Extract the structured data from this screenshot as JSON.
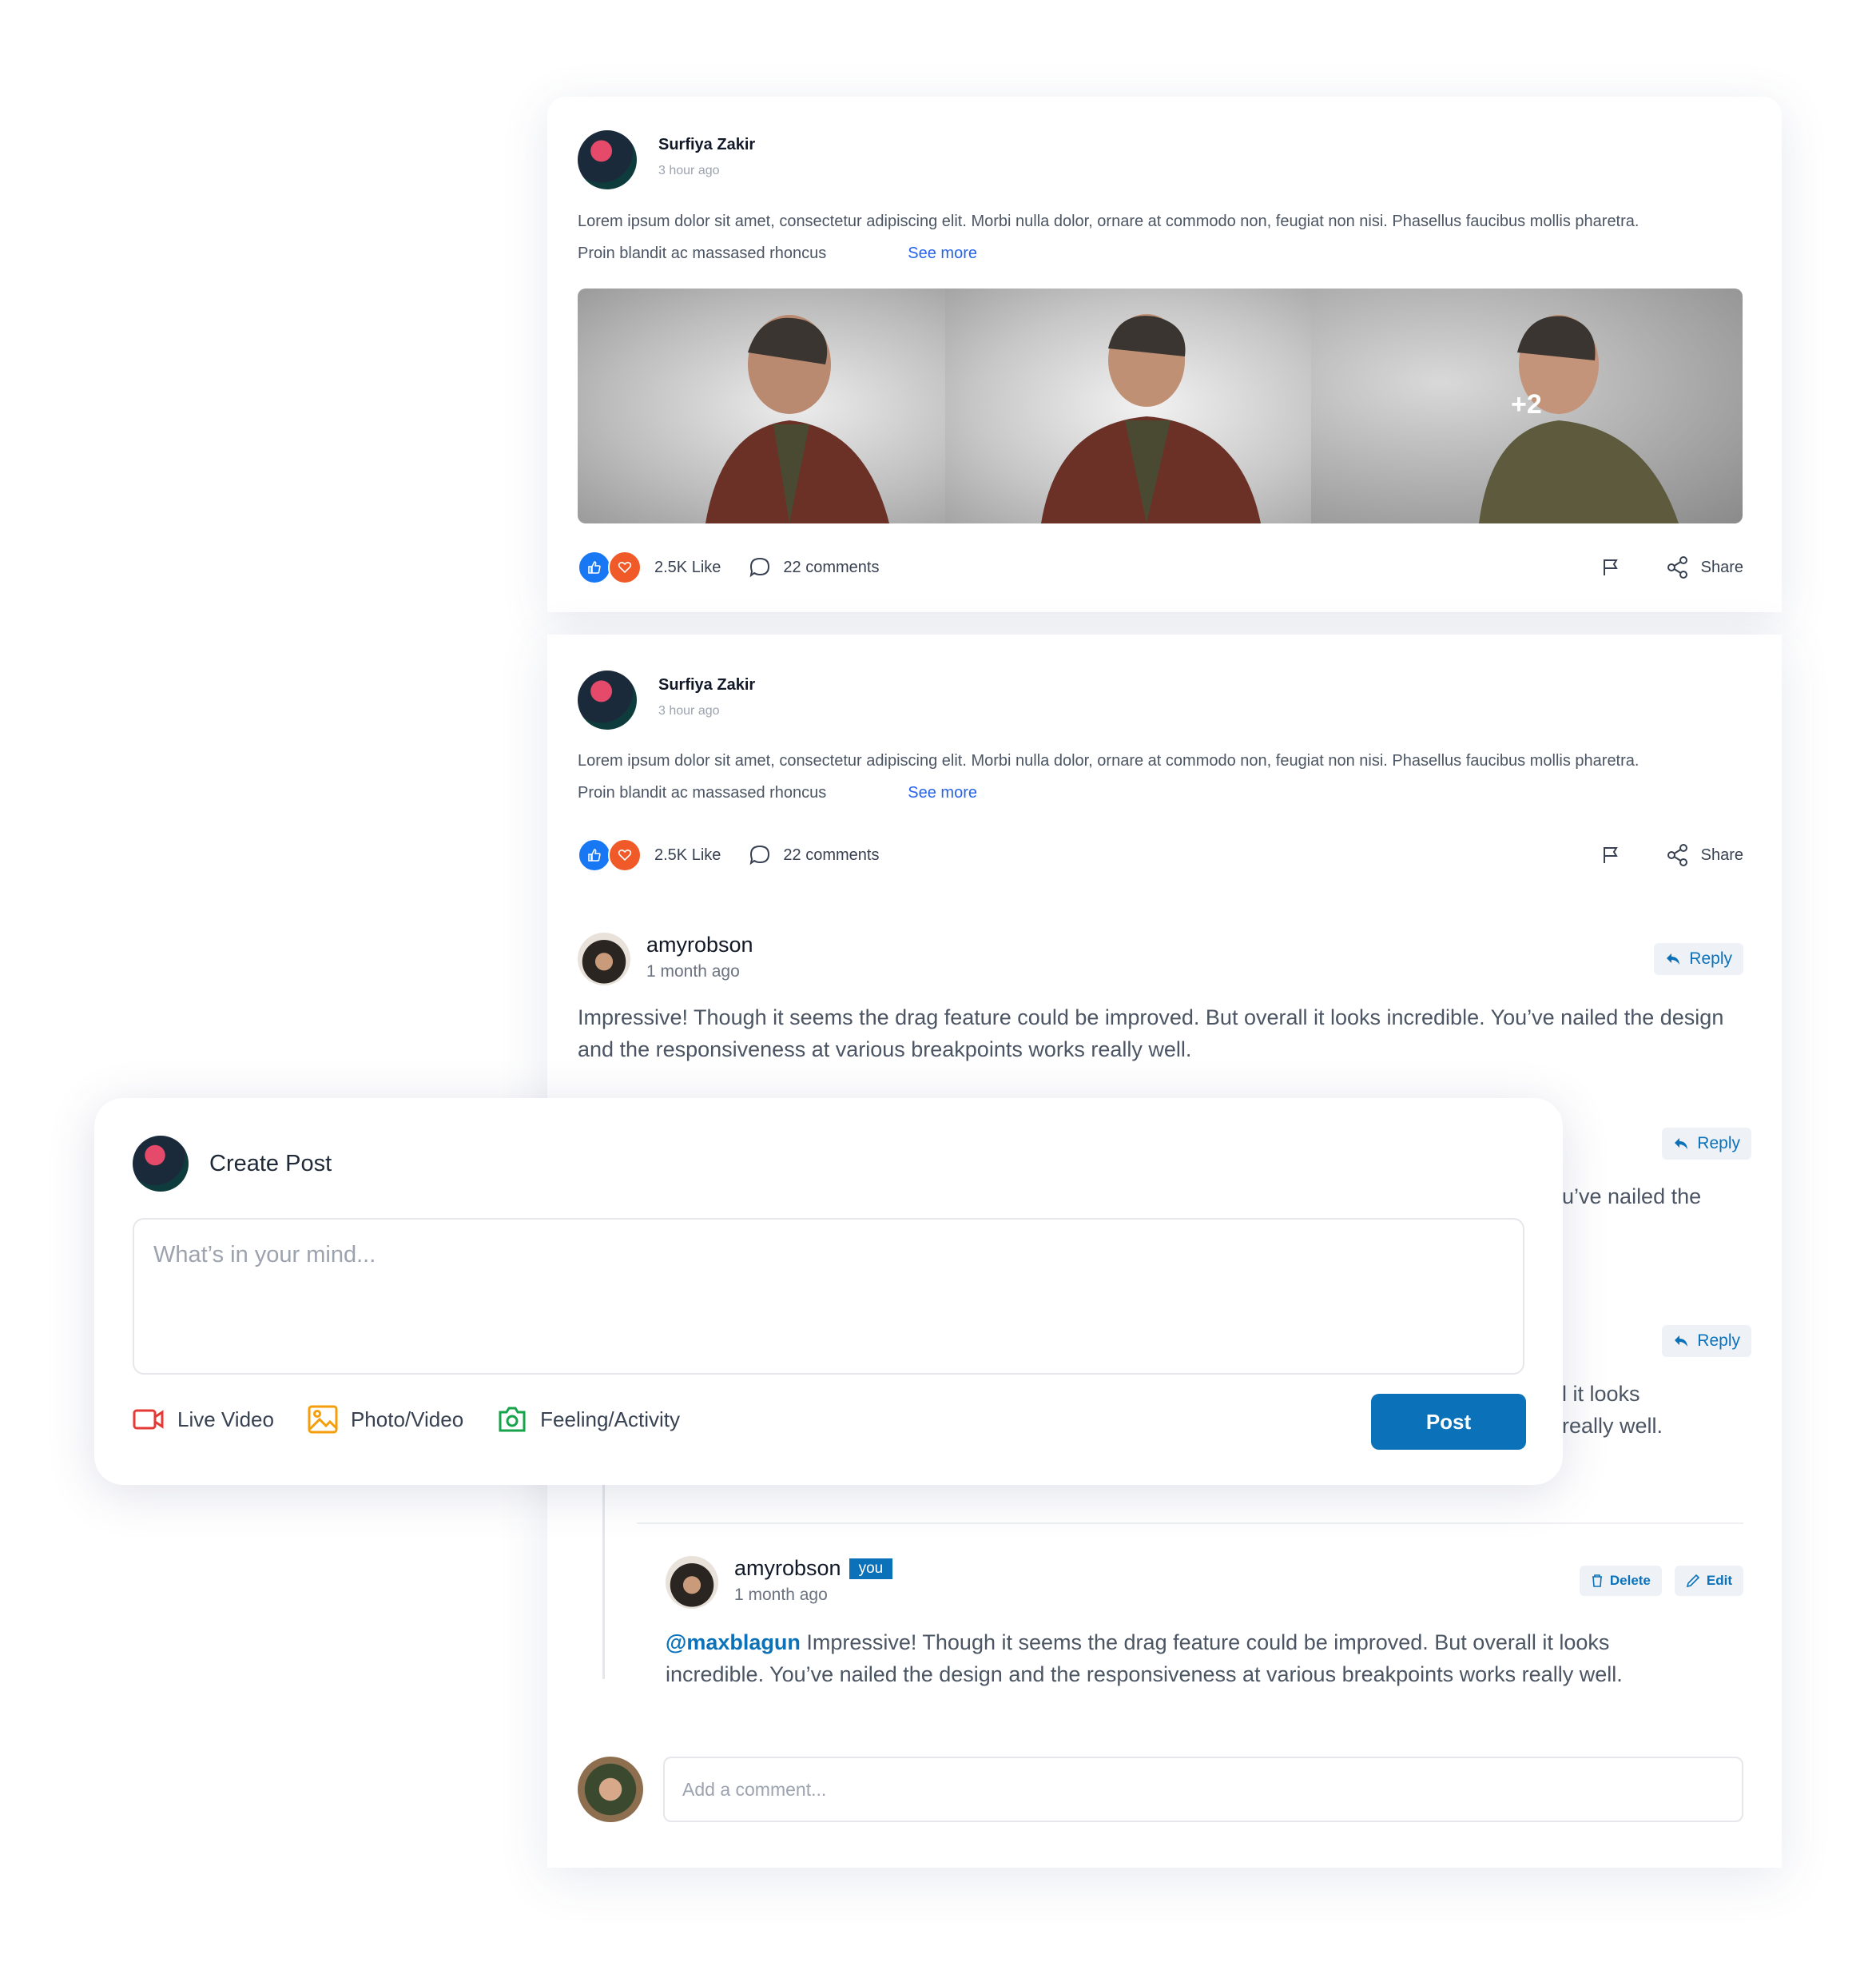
{
  "post1": {
    "author": "Surfiya Zakir",
    "time": "3 hour ago",
    "text_line1": "Lorem ipsum dolor sit amet, consectetur adipiscing elit. Morbi nulla dolor, ornare at commodo non, feugiat non nisi. Phasellus faucibus mollis pharetra.",
    "text_line2": "Proin blandit ac massased rhoncus",
    "see_more": "See more",
    "more_photos": "+2",
    "likes": "2.5K Like",
    "comments": "22 comments",
    "share": "Share"
  },
  "post2": {
    "author": "Surfiya Zakir",
    "time": "3 hour ago",
    "text_line1": "Lorem ipsum dolor sit amet, consectetur adipiscing elit. Morbi nulla dolor, ornare at commodo non, feugiat non nisi. Phasellus faucibus mollis pharetra.",
    "text_line2": "Proin blandit ac massased rhoncus",
    "see_more": "See more",
    "likes": "2.5K Like",
    "comments": "22 comments",
    "share": "Share"
  },
  "comment1": {
    "user": "amyrobson",
    "time": "1 month ago",
    "text": "Impressive! Though it seems the drag feature could be improved. But overall it looks incredible. You’ve nailed the design and the responsiveness at various breakpoints works really well.",
    "reply": "Reply"
  },
  "hidden_comments": {
    "reply2": "Reply",
    "reply3": "Reply",
    "frag1": "u’ve nailed the",
    "frag2": "l it looks",
    "frag3": "really well."
  },
  "own_reply": {
    "user": "amyrobson",
    "badge": "you",
    "time": "1 month ago",
    "mention": "@maxblagun",
    "text_line1": " Impressive! Though it seems the drag feature could be improved. But overall it looks",
    "text_line2": "incredible. You’ve nailed the design and the responsiveness at various breakpoints works really well.",
    "delete": "Delete",
    "edit": "Edit"
  },
  "add_comment": {
    "placeholder": "Add a comment..."
  },
  "create_post": {
    "title": "Create Post",
    "placeholder": "What’s in your mind...",
    "live_video": "Live Video",
    "photo_video": "Photo/Video",
    "feeling": "Feeling/Activity",
    "post_button": "Post"
  },
  "colors": {
    "accent": "#0b72b9",
    "like_blue": "#1877f2",
    "love_orange": "#f05a28",
    "live_red": "#e53935",
    "photo_orange": "#f59e0b",
    "feeling_green": "#16a34a"
  }
}
